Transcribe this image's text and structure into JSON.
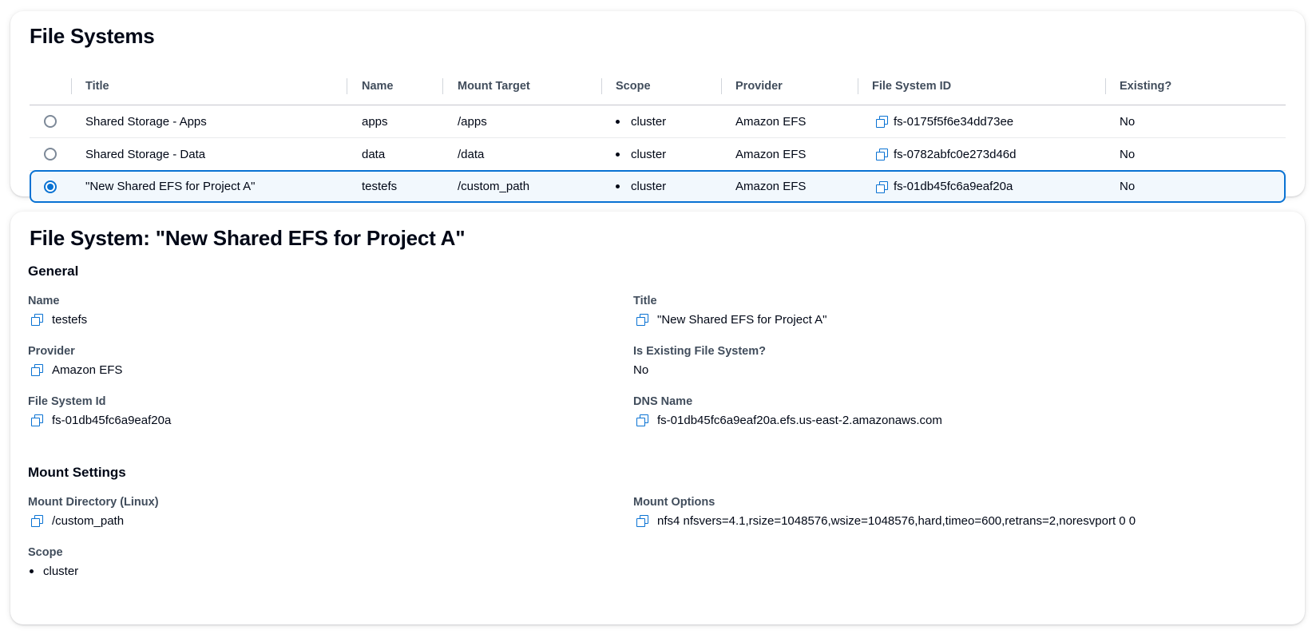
{
  "list": {
    "title": "File Systems",
    "columns": [
      "Title",
      "Name",
      "Mount Target",
      "Scope",
      "Provider",
      "File System ID",
      "Existing?"
    ],
    "rows": [
      {
        "title": "Shared Storage - Apps",
        "name": "apps",
        "mount": "/apps",
        "scope": "cluster",
        "provider": "Amazon EFS",
        "fsid": "fs-0175f5f6e34dd73ee",
        "existing": "No",
        "selected": false
      },
      {
        "title": "Shared Storage - Data",
        "name": "data",
        "mount": "/data",
        "scope": "cluster",
        "provider": "Amazon EFS",
        "fsid": "fs-0782abfc0e273d46d",
        "existing": "No",
        "selected": false
      },
      {
        "title": "\"New Shared EFS for Project A\"",
        "name": "testefs",
        "mount": "/custom_path",
        "scope": "cluster",
        "provider": "Amazon EFS",
        "fsid": "fs-01db45fc6a9eaf20a",
        "existing": "No",
        "selected": true
      }
    ]
  },
  "detail": {
    "title": "File System: \"New Shared EFS for Project A\"",
    "general": {
      "heading": "General",
      "name_label": "Name",
      "name_value": "testefs",
      "title_label": "Title",
      "title_value": "\"New Shared EFS for Project A\"",
      "provider_label": "Provider",
      "provider_value": "Amazon EFS",
      "existing_label": "Is Existing File System?",
      "existing_value": "No",
      "fsid_label": "File System Id",
      "fsid_value": "fs-01db45fc6a9eaf20a",
      "dns_label": "DNS Name",
      "dns_value": "fs-01db45fc6a9eaf20a.efs.us-east-2.amazonaws.com"
    },
    "mount": {
      "heading": "Mount Settings",
      "dir_label": "Mount Directory (Linux)",
      "dir_value": "/custom_path",
      "options_label": "Mount Options",
      "options_value": "nfs4 nfsvers=4.1,rsize=1048576,wsize=1048576,hard,timeo=600,retrans=2,noresvport 0 0",
      "scope_label": "Scope",
      "scope_value": "cluster"
    }
  },
  "colors": {
    "accent": "#0972d3",
    "selected_bg": "#f2f8fd",
    "label": "#414d5c"
  }
}
